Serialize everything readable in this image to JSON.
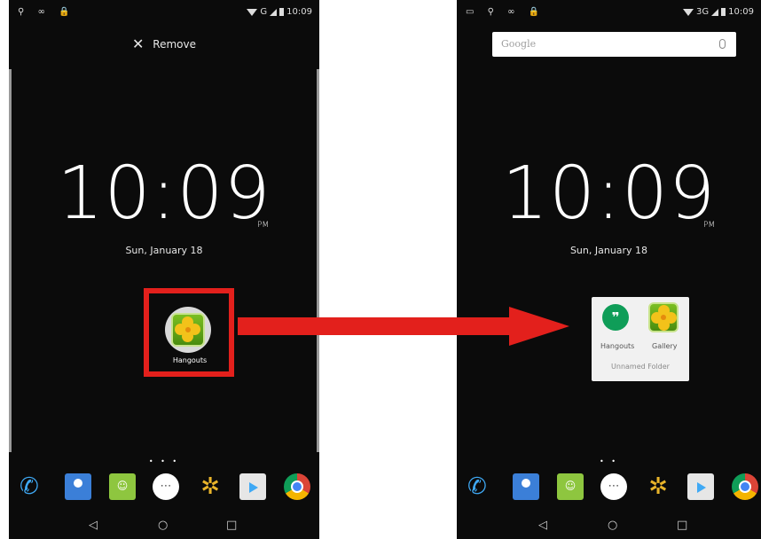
{
  "left_screen": {
    "status_time": "10:09",
    "status_network": "G",
    "remove_label": "Remove",
    "remove_icon": "close-icon",
    "clock_time": "10:09",
    "clock_ampm": "PM",
    "date": "Sun, January 18",
    "dragged_app_label": "Hangouts",
    "dragged_app_icon": "gallery-icon",
    "highlight_color": "#e3201c"
  },
  "right_screen": {
    "status_time": "10:09",
    "status_network": "3G",
    "search_logo": "Google",
    "clock_time": "10:09",
    "clock_ampm": "PM",
    "date": "Sun, January 18",
    "folder": {
      "name": "Unnamed Folder",
      "apps": [
        {
          "label": "Hangouts",
          "icon": "hangouts-icon"
        },
        {
          "label": "Gallery",
          "icon": "gallery-icon"
        }
      ]
    }
  },
  "dock": [
    "phone-icon",
    "contacts-icon",
    "messaging-icon",
    "app-drawer-icon",
    "photos-icon",
    "play-store-icon",
    "chrome-icon"
  ],
  "nav": [
    "back-icon",
    "home-icon",
    "recents-icon"
  ],
  "arrow_color": "#e3201c"
}
